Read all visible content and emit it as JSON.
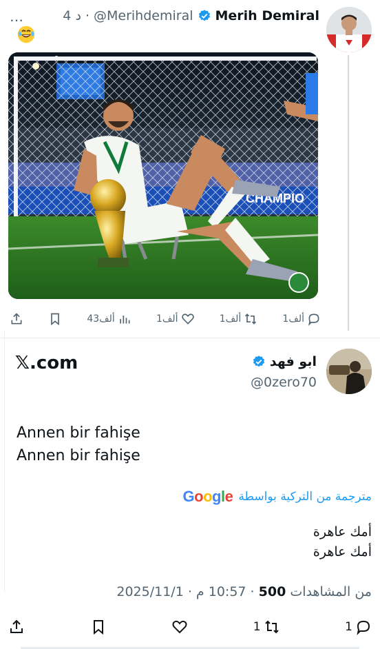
{
  "quoted_tweet": {
    "more_label": "…",
    "display_name": "Merih Demiral",
    "handle": "@Merihdemiral",
    "time": "4 د ·",
    "emoji_name": "laughing-face-icon",
    "actions": {
      "reply_count": "1ألف",
      "retweet_count": "1ألف",
      "like_count": "1ألف",
      "views_count": "43ألف"
    },
    "media_text": "CHAMPIO"
  },
  "reply_tweet": {
    "site_label": "𝕏.com",
    "display_name": "ابو فهد",
    "handle": "@0zero70",
    "text_lines": [
      "Annen bir fahişe",
      "Annen bir fahişe"
    ],
    "translate_label": "مترجمة من التركية بواسطة",
    "translate_brand": "Google",
    "translated_lines": [
      "أمك عاهرة",
      "أمك عاهرة"
    ],
    "meta": {
      "date": "2025/11/1",
      "time": "10:57 م",
      "views": "500",
      "views_label": "من المشاهدات"
    },
    "actions": {
      "reply_count": "1",
      "retweet_count": "1"
    }
  },
  "colors": {
    "accent": "#1d9bf0",
    "secondary_text": "#536471",
    "primary_text": "#0f1419"
  }
}
